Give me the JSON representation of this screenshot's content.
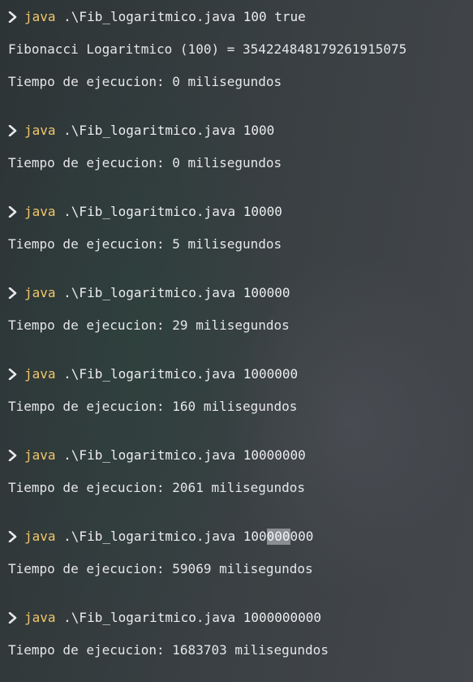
{
  "prompt_icon": "chevron-right-icon",
  "colors": {
    "java_keyword": "#f1c76a",
    "text": "#e8e8ea",
    "selection": "#8a8d92"
  },
  "blocks": [
    {
      "program": "java",
      "args": " .\\Fib_logaritmico.java 100 true",
      "outputs": [
        "Fibonacci Logaritmico (100) = 354224848179261915075",
        "Tiempo de ejecucion: 0 milisegundos"
      ]
    },
    {
      "program": "java",
      "args": " .\\Fib_logaritmico.java 1000",
      "outputs": [
        "Tiempo de ejecucion: 0 milisegundos"
      ]
    },
    {
      "program": "java",
      "args": " .\\Fib_logaritmico.java 10000",
      "outputs": [
        "Tiempo de ejecucion: 5 milisegundos"
      ]
    },
    {
      "program": "java",
      "args": " .\\Fib_logaritmico.java 100000",
      "outputs": [
        "Tiempo de ejecucion: 29 milisegundos"
      ]
    },
    {
      "program": "java",
      "args": " .\\Fib_logaritmico.java 1000000",
      "outputs": [
        "Tiempo de ejecucion: 160 milisegundos"
      ]
    },
    {
      "program": "java",
      "args": " .\\Fib_logaritmico.java 10000000",
      "outputs": [
        "Tiempo de ejecucion: 2061 milisegundos"
      ]
    },
    {
      "program": "java",
      "args_before": " .\\Fib_logaritmico.java 100",
      "args_selected": "000",
      "args_after": "000",
      "outputs": [
        "Tiempo de ejecucion: 59069 milisegundos"
      ]
    },
    {
      "program": "java",
      "args": " .\\Fib_logaritmico.java 1000000000",
      "outputs": [
        "Tiempo de ejecucion: 1683703 milisegundos"
      ]
    }
  ]
}
